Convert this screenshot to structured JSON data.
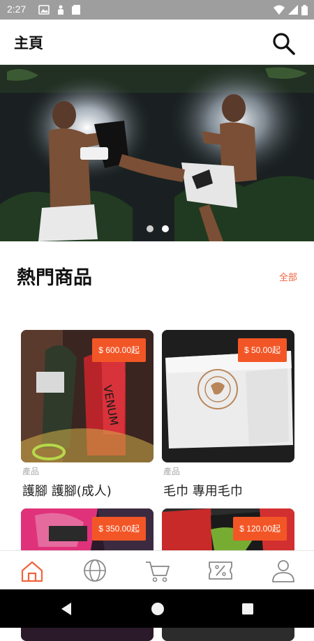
{
  "status_bar": {
    "time": "2:27"
  },
  "header": {
    "title": "主頁"
  },
  "banner": {
    "dot_count": 2,
    "active_dot": 1
  },
  "section": {
    "title": "熱門商品",
    "see_all": "全部"
  },
  "products": [
    {
      "price": "$ 600.00起",
      "category": "產品",
      "name": "護腳  護腳(成人)"
    },
    {
      "price": "$ 50.00起",
      "category": "產品",
      "name": "毛巾  專用毛巾"
    },
    {
      "price": "$ 350.00起",
      "category": "",
      "name": ""
    },
    {
      "price": "$ 120.00起",
      "category": "",
      "name": ""
    }
  ],
  "bottom_nav": {
    "items": [
      {
        "icon": "home-icon",
        "active": true
      },
      {
        "icon": "globe-icon",
        "active": false
      },
      {
        "icon": "cart-icon",
        "active": false
      },
      {
        "icon": "discount-icon",
        "active": false
      },
      {
        "icon": "profile-icon",
        "active": false
      }
    ]
  },
  "colors": {
    "accent": "#f35626",
    "active_nav": "#f0643c",
    "status_bar": "#9e9e9e"
  }
}
